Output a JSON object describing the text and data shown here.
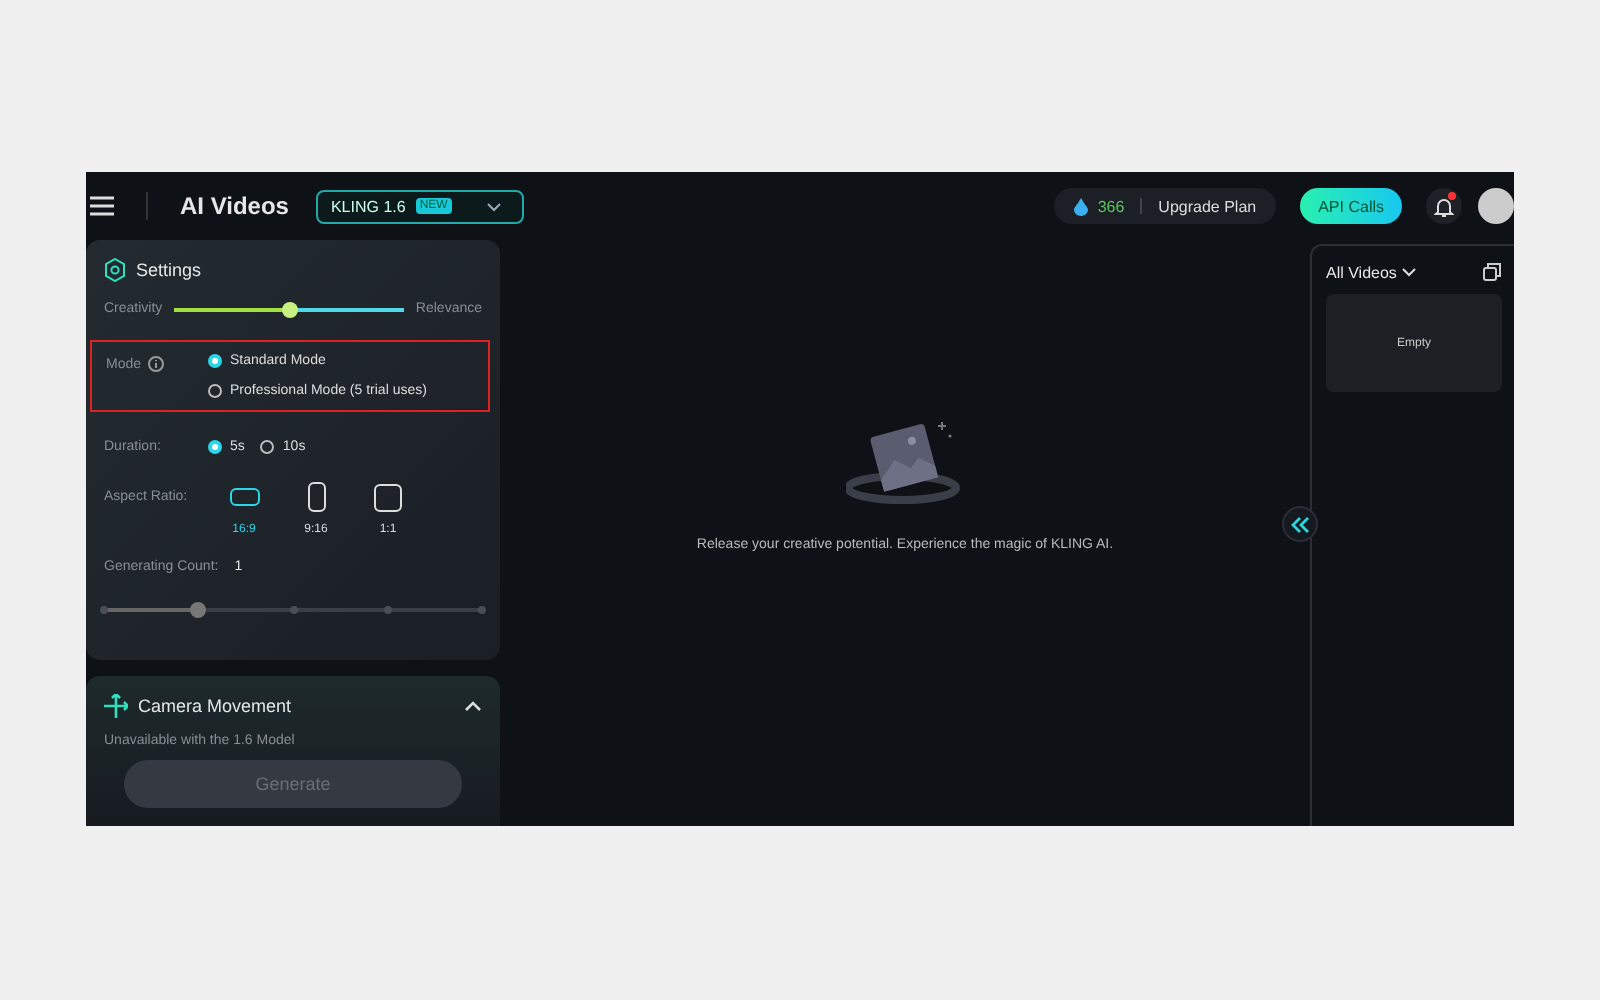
{
  "header": {
    "title": "AI Videos",
    "model": {
      "label": "KLING 1.6",
      "badge": "NEW"
    },
    "credits": "366",
    "upgrade": "Upgrade Plan",
    "api_button": "API Calls",
    "notification_unread": true
  },
  "settings": {
    "title": "Settings",
    "balance": {
      "left": "Creativity",
      "right": "Relevance",
      "level": 0.5
    },
    "mode": {
      "label": "Mode",
      "options": [
        {
          "label": "Standard Mode",
          "selected": true
        },
        {
          "label": "Professional Mode (5 trial uses)",
          "selected": false
        }
      ]
    },
    "duration": {
      "label": "Duration:",
      "options": [
        {
          "label": "5s",
          "selected": true
        },
        {
          "label": "10s",
          "selected": false
        }
      ]
    },
    "aspect_ratio": {
      "label": "Aspect Ratio:",
      "options": [
        {
          "label": "16:9",
          "kind": "wide",
          "selected": true
        },
        {
          "label": "9:16",
          "kind": "tall",
          "selected": false
        },
        {
          "label": "1:1",
          "kind": "square",
          "selected": false
        }
      ]
    },
    "count": {
      "label": "Generating Count:",
      "value": "1",
      "level": 0.25
    }
  },
  "camera": {
    "title": "Camera Movement",
    "expanded": true,
    "note": "Unavailable with the 1.6 Model",
    "generate": "Generate",
    "disabled": true
  },
  "canvas": {
    "message": "Release your creative potential. Experience the magic of KLING AI."
  },
  "library": {
    "filter": "All Videos",
    "empty": "Empty"
  }
}
